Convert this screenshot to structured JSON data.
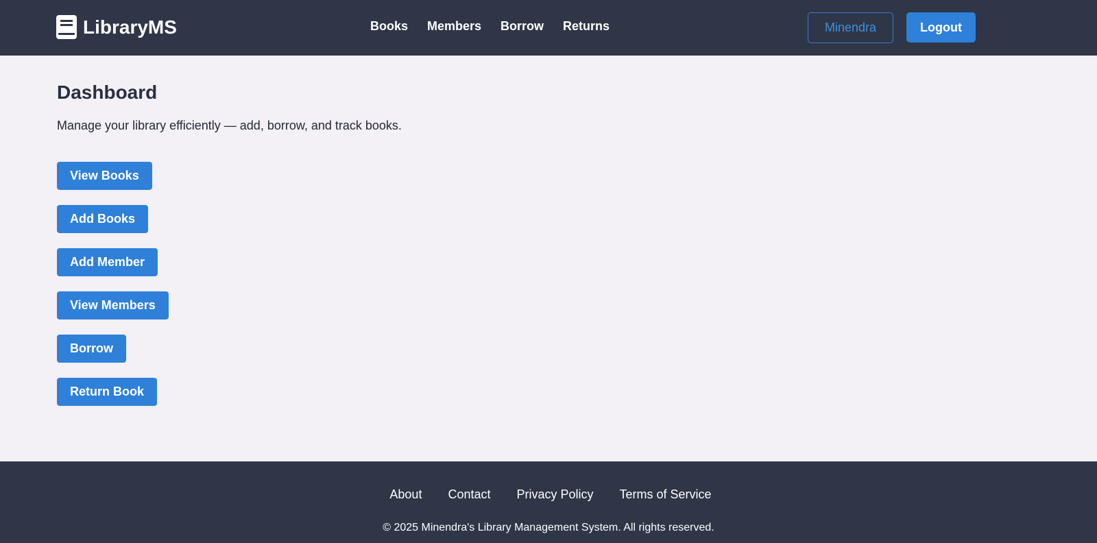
{
  "header": {
    "brand": "LibraryMS",
    "nav": [
      "Books",
      "Members",
      "Borrow",
      "Returns"
    ],
    "user_label": "Minendra",
    "logout_label": "Logout"
  },
  "main": {
    "title": "Dashboard",
    "subtitle": "Manage your library efficiently — add, borrow, and track books.",
    "actions": [
      "View Books",
      "Add Books",
      "Add Member",
      "View Members",
      "Borrow",
      "Return Book"
    ]
  },
  "footer": {
    "links": [
      "About",
      "Contact",
      "Privacy Policy",
      "Terms of Service"
    ],
    "copyright": "© 2025 Minendra's Library Management System. All rights reserved."
  },
  "colors": {
    "navbar_bg": "#2e3647",
    "page_bg": "#f3f0f6",
    "primary": "#2f80d9"
  },
  "icons": {
    "brand": "book-icon"
  }
}
